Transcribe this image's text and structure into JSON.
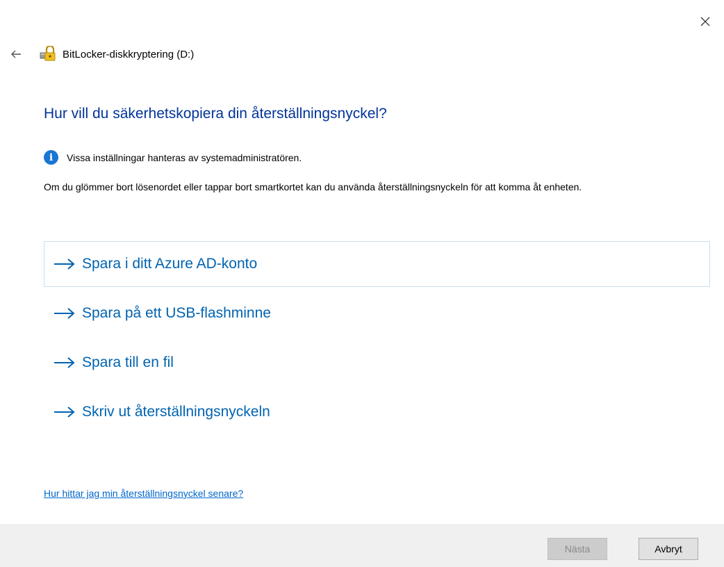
{
  "window": {
    "close_icon": "close-icon"
  },
  "titlebar": {
    "back_icon": "back-arrow-icon",
    "app_icon": "bitlocker-icon",
    "title": "BitLocker-diskkryptering (D:)"
  },
  "main": {
    "heading": "Hur vill du säkerhetskopiera din återställningsnyckel?",
    "info_icon": "info-icon",
    "info_text": "Vissa inställningar hanteras av systemadministratören.",
    "description": "Om du glömmer bort lösenordet eller tappar bort smartkortet kan du använda återställningsnyckeln för att komma åt enheten.",
    "options": [
      {
        "label": "Spara i ditt Azure AD-konto",
        "icon": "arrow-right-icon"
      },
      {
        "label": "Spara på ett USB-flashminne",
        "icon": "arrow-right-icon"
      },
      {
        "label": "Spara till en fil",
        "icon": "arrow-right-icon"
      },
      {
        "label": "Skriv ut återställningsnyckeln",
        "icon": "arrow-right-icon"
      }
    ],
    "help_link": "Hur hittar jag min återställningsnyckel senare?"
  },
  "footer": {
    "next_label": "Nästa",
    "cancel_label": "Avbryt"
  },
  "colors": {
    "heading": "#003399",
    "option_text": "#0063b1",
    "link": "#0066cc",
    "info_icon": "#1976d2",
    "footer_bg": "#f0f0f0"
  }
}
